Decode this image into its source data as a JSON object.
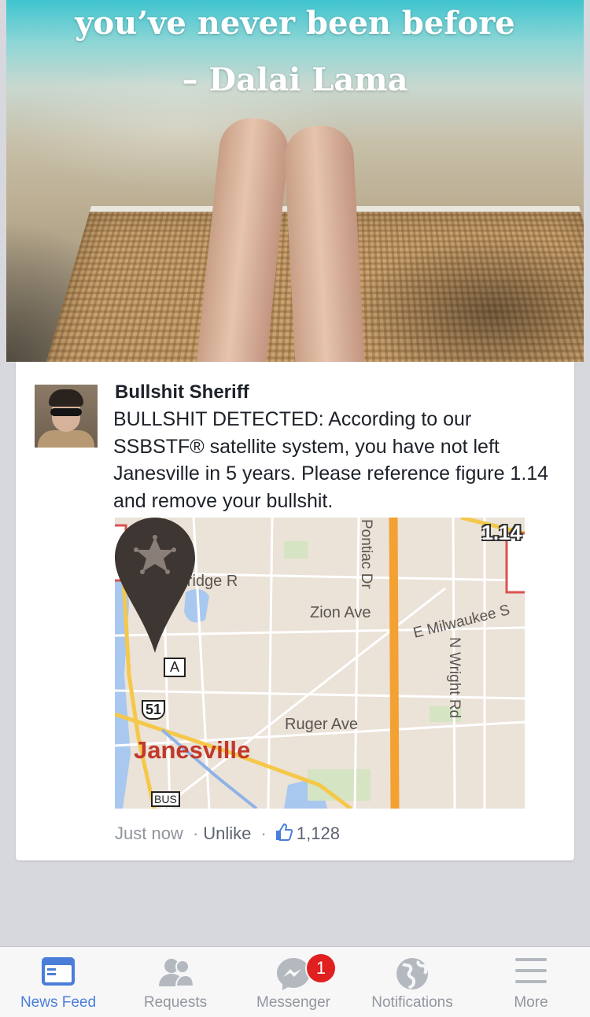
{
  "hero": {
    "quote_line1": "you’ve never been before",
    "quote_line2": "– Dalai Lama"
  },
  "post": {
    "author": "Bullshit Sheriff",
    "text": "BULLSHIT DETECTED: According to our SSBSTF® satellite system, you have not left Janesville in 5 years. Please reference figure 1.14 and remove your bullshit.",
    "map": {
      "figure_label": "1.14",
      "labels": {
        "black_bridge": "Black Bridge R",
        "zion_ave": "Zion Ave",
        "pontiac_dr": "Pontiac Dr",
        "e_milwaukee": "E Milwaukee S",
        "n_wright_rd": "N Wright Rd",
        "ruger_ave": "Ruger Ave",
        "route_a": "A",
        "route_51": "51",
        "bus": "BUS",
        "city": "Janesville"
      }
    },
    "meta": {
      "time": "Just now",
      "unlike": "Unlike",
      "like_count": "1,128"
    }
  },
  "tabbar": {
    "tabs": [
      {
        "label": "News Feed",
        "icon": "news-feed-icon",
        "active": true
      },
      {
        "label": "Requests",
        "icon": "requests-icon",
        "active": false
      },
      {
        "label": "Messenger",
        "icon": "messenger-icon",
        "active": false,
        "badge": "1"
      },
      {
        "label": "Notifications",
        "icon": "globe-icon",
        "active": false
      },
      {
        "label": "More",
        "icon": "menu-icon",
        "active": false
      }
    ]
  },
  "colors": {
    "active_tab": "#4a7ed9",
    "inactive_tab": "#92969e",
    "badge": "#e02020",
    "city_label": "#c0392b",
    "highway": "#f3a133"
  }
}
